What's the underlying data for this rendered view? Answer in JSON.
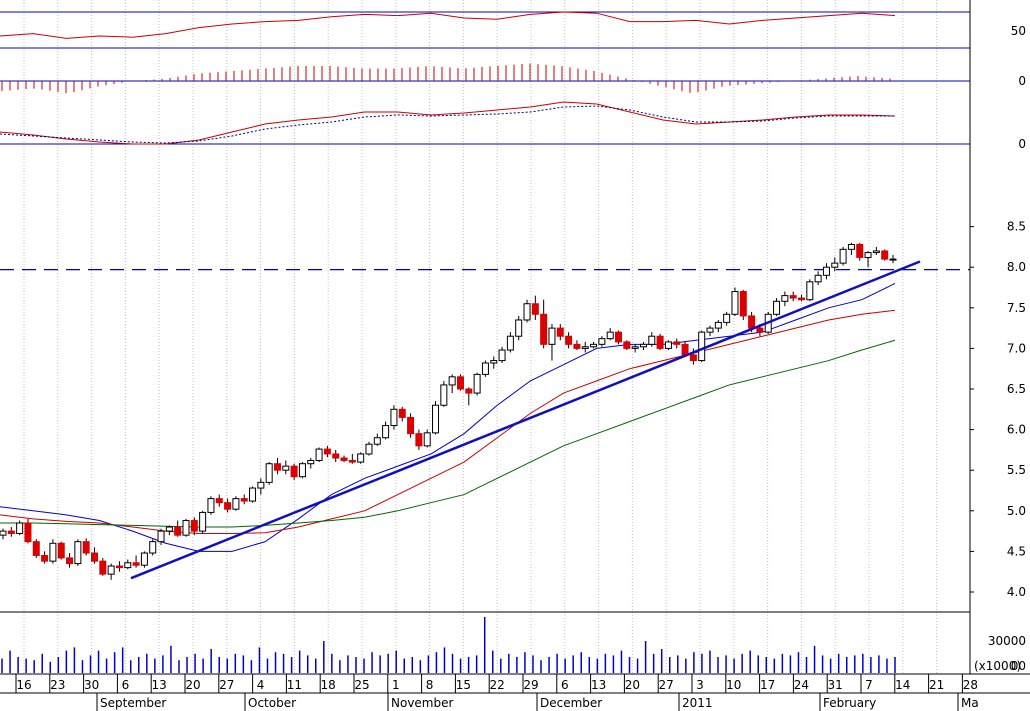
{
  "colors": {
    "frame": "#000000",
    "grid": "#c0c0c0",
    "blue": "#0000cc",
    "red": "#cc0000",
    "green": "#006600",
    "candle_up": "#ffffff",
    "candle_down": "#dd0000",
    "trendline": "#1010c0"
  },
  "chart_data": [
    {
      "type": "line",
      "name": "rsi-panel",
      "y_ticks": [
        "50"
      ],
      "levels": [
        65,
        35
      ],
      "ylim": [
        25,
        75
      ],
      "x": [
        "2010-09-13",
        "2010-09-16",
        "2010-09-23",
        "2010-09-30",
        "2010-10-06",
        "2010-10-13",
        "2010-10-20",
        "2010-10-27",
        "2010-11-04",
        "2010-11-11",
        "2010-11-18",
        "2010-11-25",
        "2010-12-01",
        "2010-12-08",
        "2010-12-15",
        "2010-12-22",
        "2010-12-29",
        "2011-01-06",
        "2011-01-13",
        "2011-01-20",
        "2011-01-27",
        "2011-02-03",
        "2011-02-10",
        "2011-02-17",
        "2011-02-24",
        "2011-03-02",
        "2011-03-09",
        "2011-03-16"
      ],
      "series": [
        {
          "values": [
            45,
            47,
            43,
            45,
            44,
            47,
            52,
            55,
            57,
            58,
            61,
            63,
            62,
            64,
            60,
            59,
            63,
            65,
            64,
            57,
            57,
            58,
            55,
            58,
            60,
            62,
            64,
            62
          ]
        }
      ]
    },
    {
      "type": "bar",
      "name": "macd-histogram",
      "y_ticks": [
        "0"
      ],
      "x": [
        "2010-09-13",
        "2010-09-16",
        "2010-09-23",
        "2010-09-30",
        "2010-10-06",
        "2010-10-13",
        "2010-10-20",
        "2010-10-27",
        "2010-11-04",
        "2010-11-11",
        "2010-11-18",
        "2010-11-25",
        "2010-12-01",
        "2010-12-08",
        "2010-12-15",
        "2010-12-22",
        "2010-12-29",
        "2011-01-06",
        "2011-01-13",
        "2011-01-20",
        "2011-01-27",
        "2011-02-03",
        "2011-02-10",
        "2011-02-17",
        "2011-02-24",
        "2011-03-02",
        "2011-03-09",
        "2011-03-16"
      ],
      "values": [
        -0.04,
        -0.03,
        -0.05,
        -0.02,
        0.0,
        0.01,
        0.03,
        0.04,
        0.05,
        0.06,
        0.06,
        0.05,
        0.05,
        0.06,
        0.05,
        0.06,
        0.07,
        0.06,
        0.04,
        0.01,
        -0.02,
        -0.05,
        -0.02,
        -0.01,
        0.0,
        0.01,
        0.02,
        0.01
      ]
    },
    {
      "type": "line",
      "name": "macd-lines",
      "y_ticks": [
        "0"
      ],
      "x": [
        "2010-09-13",
        "2010-09-16",
        "2010-09-23",
        "2010-09-30",
        "2010-10-06",
        "2010-10-13",
        "2010-10-20",
        "2010-10-27",
        "2010-11-04",
        "2010-11-11",
        "2010-11-18",
        "2010-11-25",
        "2010-12-01",
        "2010-12-08",
        "2010-12-15",
        "2010-12-22",
        "2010-12-29",
        "2011-01-06",
        "2011-01-13",
        "2011-01-20",
        "2011-01-27",
        "2011-02-03",
        "2011-02-10",
        "2011-02-17",
        "2011-02-24",
        "2011-03-02",
        "2011-03-09",
        "2011-03-16"
      ],
      "series": [
        {
          "values": [
            0.0,
            -0.03,
            -0.07,
            -0.1,
            -0.12,
            -0.12,
            -0.08,
            0.0,
            0.08,
            0.12,
            0.15,
            0.2,
            0.2,
            0.17,
            0.19,
            0.22,
            0.25,
            0.3,
            0.28,
            0.2,
            0.12,
            0.08,
            0.1,
            0.12,
            0.15,
            0.17,
            0.17,
            0.16
          ]
        },
        {
          "values": [
            -0.02,
            -0.04,
            -0.06,
            -0.08,
            -0.1,
            -0.11,
            -0.09,
            -0.04,
            0.03,
            0.07,
            0.1,
            0.15,
            0.17,
            0.16,
            0.17,
            0.18,
            0.2,
            0.25,
            0.26,
            0.22,
            0.15,
            0.1,
            0.1,
            0.11,
            0.14,
            0.16,
            0.16,
            0.16
          ]
        }
      ]
    },
    {
      "type": "candlestick",
      "name": "price-panel",
      "y_ticks": [
        "8.5",
        "8.0",
        "7.5",
        "7.0",
        "6.5",
        "6.0",
        "5.5",
        "5.0",
        "4.5",
        "4.0"
      ],
      "ylim": [
        3.85,
        8.7
      ],
      "resistance_level": 7.97,
      "x_labels": [
        "16",
        "23",
        "30",
        "6",
        "13",
        "20",
        "27",
        "4",
        "11",
        "18",
        "25",
        "1",
        "8",
        "15",
        "22",
        "29",
        "6",
        "13",
        "20",
        "27",
        "3",
        "10",
        "17",
        "24",
        "31",
        "7",
        "14",
        "21",
        "28"
      ],
      "month_labels": [
        "September",
        "October",
        "November",
        "December",
        "2011",
        "February",
        "Ma"
      ],
      "ohlc": [
        [
          4.7,
          4.78,
          4.65,
          4.75
        ],
        [
          4.75,
          4.8,
          4.68,
          4.72
        ],
        [
          4.72,
          4.88,
          4.7,
          4.85
        ],
        [
          4.85,
          4.9,
          4.6,
          4.62
        ],
        [
          4.62,
          4.65,
          4.42,
          4.45
        ],
        [
          4.45,
          4.5,
          4.35,
          4.38
        ],
        [
          4.38,
          4.65,
          4.35,
          4.6
        ],
        [
          4.6,
          4.62,
          4.4,
          4.42
        ],
        [
          4.42,
          4.48,
          4.3,
          4.35
        ],
        [
          4.35,
          4.65,
          4.32,
          4.62
        ],
        [
          4.62,
          4.66,
          4.45,
          4.48
        ],
        [
          4.48,
          4.55,
          4.35,
          4.38
        ],
        [
          4.38,
          4.42,
          4.2,
          4.22
        ],
        [
          4.22,
          4.35,
          4.15,
          4.32
        ],
        [
          4.32,
          4.38,
          4.25,
          4.3
        ],
        [
          4.3,
          4.4,
          4.28,
          4.36
        ],
        [
          4.36,
          4.45,
          4.3,
          4.33
        ],
        [
          4.33,
          4.5,
          4.3,
          4.48
        ],
        [
          4.48,
          4.65,
          4.45,
          4.62
        ],
        [
          4.62,
          4.78,
          4.58,
          4.75
        ],
        [
          4.75,
          4.82,
          4.7,
          4.8
        ],
        [
          4.8,
          4.88,
          4.68,
          4.7
        ],
        [
          4.7,
          4.9,
          4.68,
          4.88
        ],
        [
          4.88,
          4.92,
          4.7,
          4.75
        ],
        [
          4.75,
          5.0,
          4.72,
          4.98
        ],
        [
          4.98,
          5.18,
          4.95,
          5.15
        ],
        [
          5.15,
          5.2,
          5.05,
          5.1
        ],
        [
          5.1,
          5.15,
          4.98,
          5.02
        ],
        [
          5.02,
          5.18,
          5.0,
          5.15
        ],
        [
          5.15,
          5.2,
          5.08,
          5.12
        ],
        [
          5.12,
          5.3,
          5.1,
          5.28
        ],
        [
          5.28,
          5.4,
          5.2,
          5.35
        ],
        [
          5.35,
          5.6,
          5.32,
          5.58
        ],
        [
          5.58,
          5.65,
          5.45,
          5.5
        ],
        [
          5.5,
          5.62,
          5.45,
          5.55
        ],
        [
          5.55,
          5.58,
          5.38,
          5.42
        ],
        [
          5.42,
          5.6,
          5.4,
          5.58
        ],
        [
          5.58,
          5.65,
          5.52,
          5.62
        ],
        [
          5.62,
          5.78,
          5.6,
          5.76
        ],
        [
          5.76,
          5.8,
          5.66,
          5.7
        ],
        [
          5.7,
          5.75,
          5.6,
          5.65
        ],
        [
          5.65,
          5.68,
          5.6,
          5.62
        ],
        [
          5.62,
          5.7,
          5.58,
          5.6
        ],
        [
          5.6,
          5.72,
          5.58,
          5.7
        ],
        [
          5.7,
          5.85,
          5.68,
          5.82
        ],
        [
          5.82,
          5.95,
          5.8,
          5.9
        ],
        [
          5.9,
          6.1,
          5.88,
          6.05
        ],
        [
          6.05,
          6.3,
          6.0,
          6.25
        ],
        [
          6.25,
          6.28,
          6.1,
          6.15
        ],
        [
          6.15,
          6.2,
          5.9,
          5.95
        ],
        [
          5.95,
          6.0,
          5.75,
          5.8
        ],
        [
          5.8,
          6.0,
          5.78,
          5.96
        ],
        [
          5.96,
          6.35,
          5.94,
          6.3
        ],
        [
          6.3,
          6.6,
          6.28,
          6.55
        ],
        [
          6.55,
          6.68,
          6.45,
          6.65
        ],
        [
          6.65,
          6.68,
          6.48,
          6.5
        ],
        [
          6.5,
          6.52,
          6.3,
          6.45
        ],
        [
          6.45,
          6.7,
          6.42,
          6.68
        ],
        [
          6.68,
          6.85,
          6.65,
          6.82
        ],
        [
          6.82,
          6.9,
          6.75,
          6.85
        ],
        [
          6.85,
          7.02,
          6.82,
          6.98
        ],
        [
          6.98,
          7.2,
          6.95,
          7.15
        ],
        [
          7.15,
          7.4,
          7.1,
          7.35
        ],
        [
          7.35,
          7.6,
          7.32,
          7.55
        ],
        [
          7.55,
          7.65,
          7.35,
          7.42
        ],
        [
          7.42,
          7.6,
          7.0,
          7.05
        ],
        [
          7.05,
          7.3,
          6.85,
          7.25
        ],
        [
          7.25,
          7.3,
          7.1,
          7.15
        ],
        [
          7.15,
          7.2,
          7.0,
          7.05
        ],
        [
          7.05,
          7.1,
          6.98,
          7.0
        ],
        [
          7.0,
          7.08,
          6.95,
          7.02
        ],
        [
          7.02,
          7.08,
          7.0,
          7.05
        ],
        [
          7.05,
          7.15,
          7.02,
          7.12
        ],
        [
          7.12,
          7.25,
          7.1,
          7.2
        ],
        [
          7.2,
          7.22,
          7.05,
          7.08
        ],
        [
          7.08,
          7.1,
          6.98,
          7.0
        ],
        [
          7.0,
          7.05,
          6.95,
          7.02
        ],
        [
          7.02,
          7.08,
          6.98,
          7.05
        ],
        [
          7.05,
          7.2,
          7.02,
          7.15
        ],
        [
          7.15,
          7.18,
          6.98,
          7.0
        ],
        [
          7.0,
          7.1,
          6.98,
          7.08
        ],
        [
          7.08,
          7.12,
          7.0,
          7.05
        ],
        [
          7.05,
          7.08,
          6.9,
          6.92
        ],
        [
          6.92,
          7.0,
          6.8,
          6.85
        ],
        [
          6.85,
          7.22,
          6.83,
          7.2
        ],
        [
          7.2,
          7.28,
          7.15,
          7.25
        ],
        [
          7.25,
          7.35,
          7.2,
          7.32
        ],
        [
          7.32,
          7.45,
          7.28,
          7.42
        ],
        [
          7.42,
          7.75,
          7.4,
          7.7
        ],
        [
          7.7,
          7.72,
          7.35,
          7.4
        ],
        [
          7.4,
          7.45,
          7.2,
          7.25
        ],
        [
          7.25,
          7.3,
          7.15,
          7.2
        ],
        [
          7.2,
          7.45,
          7.18,
          7.42
        ],
        [
          7.42,
          7.62,
          7.4,
          7.58
        ],
        [
          7.58,
          7.7,
          7.52,
          7.65
        ],
        [
          7.65,
          7.7,
          7.58,
          7.62
        ],
        [
          7.62,
          7.66,
          7.58,
          7.6
        ],
        [
          7.6,
          7.85,
          7.58,
          7.82
        ],
        [
          7.82,
          7.95,
          7.78,
          7.9
        ],
        [
          7.9,
          8.05,
          7.85,
          8.0
        ],
        [
          8.0,
          8.12,
          7.95,
          8.05
        ],
        [
          8.05,
          8.25,
          8.02,
          8.22
        ],
        [
          8.22,
          8.3,
          8.15,
          8.28
        ],
        [
          8.28,
          8.3,
          8.08,
          8.12
        ],
        [
          8.12,
          8.2,
          8.0,
          8.18
        ],
        [
          8.18,
          8.25,
          8.15,
          8.2
        ],
        [
          8.2,
          8.22,
          8.08,
          8.1
        ],
        [
          8.1,
          8.15,
          8.05,
          8.1
        ]
      ],
      "series": [
        {
          "values": [
            5.05,
            5.0,
            4.95,
            4.88,
            4.75,
            4.6,
            4.5,
            4.5,
            4.62,
            4.9,
            5.2,
            5.4,
            5.55,
            5.7,
            5.95,
            6.3,
            6.6,
            6.8,
            7.0,
            7.05,
            7.05,
            7.1,
            7.15,
            7.2,
            7.35,
            7.5,
            7.6,
            7.8
          ]
        },
        {
          "values": [
            4.95,
            4.9,
            4.87,
            4.85,
            4.8,
            4.75,
            4.72,
            4.72,
            4.73,
            4.8,
            4.9,
            5.0,
            5.2,
            5.4,
            5.6,
            5.9,
            6.2,
            6.45,
            6.6,
            6.75,
            6.85,
            6.95,
            7.05,
            7.15,
            7.25,
            7.35,
            7.42,
            7.47
          ]
        },
        {
          "values": [
            4.85,
            4.85,
            4.84,
            4.83,
            4.82,
            4.81,
            4.8,
            4.8,
            4.82,
            4.85,
            4.88,
            4.92,
            5.0,
            5.1,
            5.2,
            5.4,
            5.6,
            5.8,
            5.95,
            6.1,
            6.25,
            6.4,
            6.55,
            6.65,
            6.75,
            6.85,
            6.98,
            7.1
          ]
        }
      ],
      "trendline": [
        [
          4.17,
          8.07
        ]
      ]
    },
    {
      "type": "bar",
      "name": "volume-panel",
      "y_ticks": [
        "30000"
      ],
      "corner_label": "(x1000)",
      "bottom_label": "00",
      "values": [
        9,
        14,
        10,
        9,
        8,
        12,
        7,
        10,
        14,
        16,
        8,
        11,
        14,
        9,
        13,
        16,
        8,
        10,
        12,
        9,
        11,
        17,
        8,
        10,
        12,
        9,
        15,
        10,
        9,
        12,
        11,
        8,
        16,
        9,
        13,
        12,
        10,
        14,
        11,
        9,
        20,
        12,
        8,
        11,
        10,
        9,
        13,
        11,
        12,
        14,
        9,
        10,
        8,
        11,
        13,
        16,
        12,
        9,
        10,
        11,
        35,
        14,
        9,
        12,
        10,
        13,
        11,
        8,
        10,
        12,
        9,
        11,
        13,
        10,
        9,
        12,
        11,
        14,
        10,
        9,
        20,
        12,
        15,
        10,
        11,
        9,
        13,
        12,
        14,
        10,
        11,
        9,
        12,
        14,
        11,
        10,
        9,
        12,
        11,
        13,
        10,
        17,
        11,
        9,
        12,
        10,
        11,
        12,
        10,
        11,
        9,
        10
      ]
    }
  ]
}
